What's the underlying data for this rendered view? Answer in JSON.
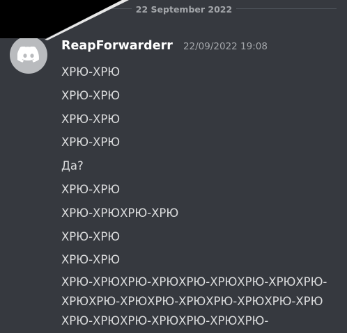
{
  "divider": {
    "date_label": "22 September 2022"
  },
  "message_group": {
    "avatar_icon": "discord-logo-icon",
    "username": "ReapForwarderr",
    "timestamp": "22/09/2022 19:08",
    "messages": [
      "ХРЮ-ХРЮ",
      "ХРЮ-ХРЮ",
      "ХРЮ-ХРЮ",
      "ХРЮ-ХРЮ",
      "Да?",
      "ХРЮ-ХРЮ",
      "ХРЮ-ХРЮХРЮ-ХРЮ",
      "ХРЮ-ХРЮ",
      "ХРЮ-ХРЮ"
    ],
    "long_message": "ХРЮ-ХРЮХРЮ-ХРЮХРЮ-ХРЮХРЮ-ХРЮХРЮ-ХРЮХРЮ-ХРЮХРЮ-ХРЮХРЮ-ХРЮХРЮ-ХРЮХРЮ-ХРЮХРЮ-ХРЮХРЮ-ХРЮХРЮ-"
  },
  "colors": {
    "background": "#36393f",
    "username": "#ffffff",
    "message_text": "#dcddde",
    "muted_text": "#a3a6aa",
    "avatar_bg": "#b9bbbe"
  }
}
